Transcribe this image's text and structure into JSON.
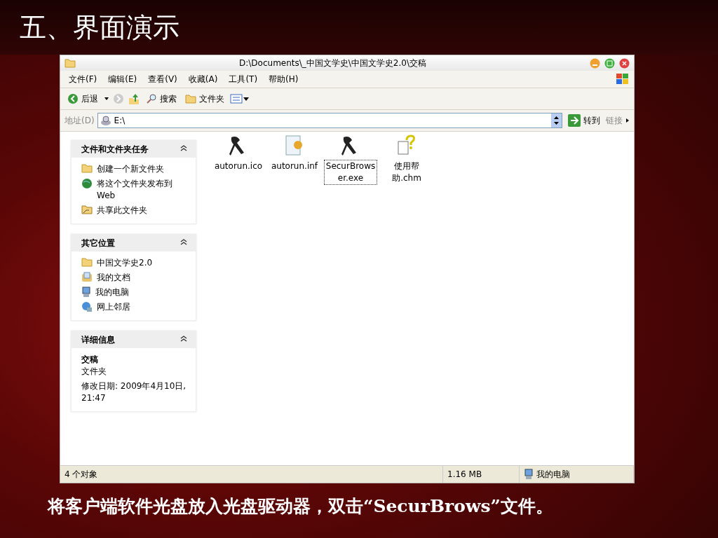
{
  "slide_title": "五、界面演示",
  "window": {
    "title": "D:\\Documents\\_中国文学史\\中国文学史2.0\\交稿"
  },
  "menu": [
    "文件(F)",
    "编辑(E)",
    "查看(V)",
    "收藏(A)",
    "工具(T)",
    "帮助(H)"
  ],
  "toolbar": {
    "back": "后退",
    "search": "搜索",
    "folders": "文件夹"
  },
  "address": {
    "label": "地址(D)",
    "value": "E:\\",
    "go": "转到",
    "links": "链接"
  },
  "panels": [
    {
      "title": "文件和文件夹任务",
      "kind": "links",
      "items": [
        {
          "label": "创建一个新文件夹"
        },
        {
          "label": "将这个文件夹发布到 Web"
        },
        {
          "label": "共享此文件夹"
        }
      ]
    },
    {
      "title": "其它位置",
      "kind": "links",
      "items": [
        {
          "label": "中国文学史2.0"
        },
        {
          "label": "我的文档"
        },
        {
          "label": "我的电脑"
        },
        {
          "label": "网上邻居"
        }
      ]
    },
    {
      "title": "详细信息",
      "kind": "details",
      "name": "交稿",
      "type": "文件夹",
      "modified": "修改日期: 2009年4月10日, 21:47"
    }
  ],
  "files": [
    {
      "name": "autorun.ico",
      "kind": "icon",
      "selected": false
    },
    {
      "name": "autorun.inf",
      "kind": "setup",
      "selected": false
    },
    {
      "name": "SecurBrowser.exe",
      "kind": "program",
      "selected": true
    },
    {
      "name": "使用帮助.chm",
      "kind": "help",
      "selected": false
    }
  ],
  "status_bar": {
    "count": "4 个对象",
    "size": "1.16 MB",
    "location": "我的电脑"
  },
  "caption": "将客户端软件光盘放入光盘驱动器，双击“SecurBrows”文件。"
}
